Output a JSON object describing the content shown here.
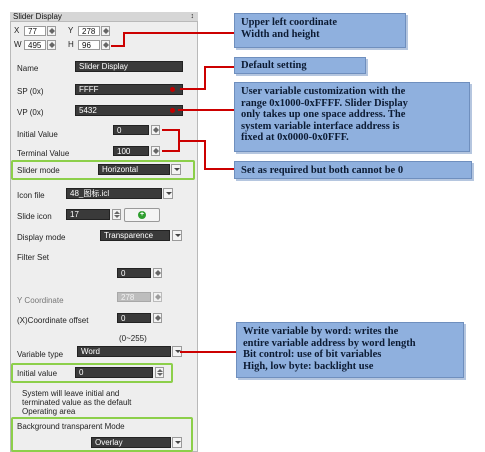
{
  "panel": {
    "title": "Slider Display",
    "pin_glyph": "↕",
    "x_label": "X",
    "x_value": "77",
    "y_label": "Y",
    "y_value": "278",
    "w_label": "W",
    "w_value": "495",
    "h_label": "H",
    "h_value": "96",
    "name_label": "Name",
    "name_value": "Slider Display",
    "sp_label": "SP (0x)",
    "sp_value": "FFFF",
    "vp_label": "VP (0x)",
    "vp_value": "5432",
    "initial_label": "Initial Value",
    "initial_value": "0",
    "terminal_label": "Terminal Value",
    "terminal_value": "100",
    "slider_mode_label": "Slider mode",
    "slider_mode_value": "Horizontal",
    "icon_file_label": "Icon file",
    "icon_file_value": "48_图标.icl",
    "slide_icon_label": "Slide icon",
    "slide_icon_value": "17",
    "add_glyph": "+",
    "display_mode_label": "Display mode",
    "display_mode_value": "Transparence",
    "filter_set_label": "Filter Set",
    "filter_set_value": "0",
    "y_coord_label": "Y Coordinate",
    "y_coord_value": "278",
    "x_offset_label": "(X)Coordinate offset",
    "x_offset_value": "0",
    "x_offset_range": "(0~255)",
    "variable_type_label": "Variable type",
    "variable_type_value": "Word",
    "initial_value2_label": "Initial value",
    "initial_value2_value": "0",
    "note_line1": "System will leave initial and",
    "note_line2": "terminated value as the default",
    "note_line3": "Operating area",
    "bg_mode_label": "Background transparent Mode",
    "bg_mode_value": "Overlay"
  },
  "annotations": {
    "coords_line1": "Upper left coordinate",
    "coords_line2": "Width and height",
    "default": "Default setting",
    "variable_line1": "User variable customization with the",
    "variable_line2": "range 0x1000-0xFFFF. Slider Display",
    "variable_line3": "only takes up one space address. The",
    "variable_line4": "system variable interface address is",
    "variable_line5": "fixed at 0x0000-0x0FFF.",
    "required": "Set as required but both cannot be 0",
    "write_line1": "Write variable by word: writes the",
    "write_line2": "entire variable address by word length",
    "write_line3": "Bit control: use of bit variables",
    "write_line4": "High, low byte: backlight use"
  },
  "colors": {
    "annotation_box": "#8fb0de",
    "highlight": "#8ccf4a",
    "leader_line": "#cc0000"
  }
}
